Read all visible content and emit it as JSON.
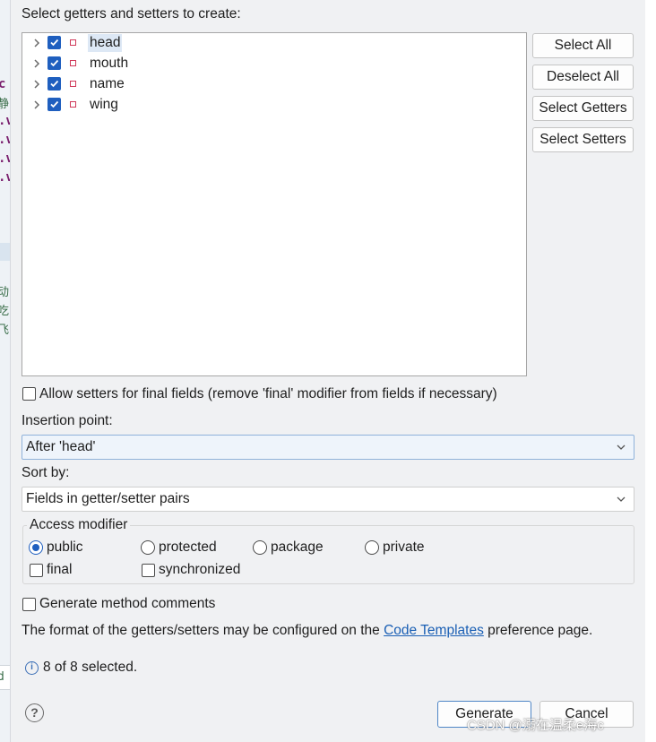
{
  "dialog": {
    "heading": "Select getters and setters to create:",
    "fields": [
      {
        "name": "head",
        "checked": true,
        "selected": true
      },
      {
        "name": "mouth",
        "checked": true,
        "selected": false
      },
      {
        "name": "name",
        "checked": true,
        "selected": false
      },
      {
        "name": "wing",
        "checked": true,
        "selected": false
      }
    ],
    "side_buttons": {
      "select_all": "Select All",
      "deselect_all": "Deselect All",
      "select_getters": "Select Getters",
      "select_setters": "Select Setters"
    },
    "allow_setters_final": {
      "label": "Allow setters for final fields (remove 'final' modifier from fields if necessary)",
      "checked": false
    },
    "insertion_point": {
      "label": "Insertion point:",
      "value": "After 'head'"
    },
    "sort_by": {
      "label": "Sort by:",
      "value": "Fields in getter/setter pairs"
    },
    "access_modifier": {
      "label": "Access modifier",
      "options": [
        "public",
        "protected",
        "package",
        "private"
      ],
      "selected": "public",
      "final_label": "final",
      "final_checked": false,
      "synchronized_label": "synchronized",
      "synchronized_checked": false
    },
    "generate_comments": {
      "label": "Generate method comments",
      "checked": false
    },
    "format_note": {
      "before": "The format of the getters/setters may be configured on the",
      "link": "Code Templates",
      "after": "preference page."
    },
    "status": "8 of 8 selected.",
    "buttons": {
      "generate": "Generate",
      "cancel": "Cancel"
    }
  },
  "background_editor": {
    "fragments": [
      "c",
      "静",
      ".v",
      ".v",
      ".v",
      ".v",
      "动",
      "吃",
      "飞",
      "d"
    ]
  },
  "watermark": "CSDN @溺在温柔e海c",
  "colors": {
    "accent": "#1f5fbf",
    "link": "#1a5fb4",
    "dialog_bg": "#f0f1f3"
  },
  "icons": {
    "expand": "chevron-right-icon",
    "field": "field-icon",
    "dropdown": "chevron-down-icon",
    "info": "info-icon",
    "help": "help-icon"
  }
}
